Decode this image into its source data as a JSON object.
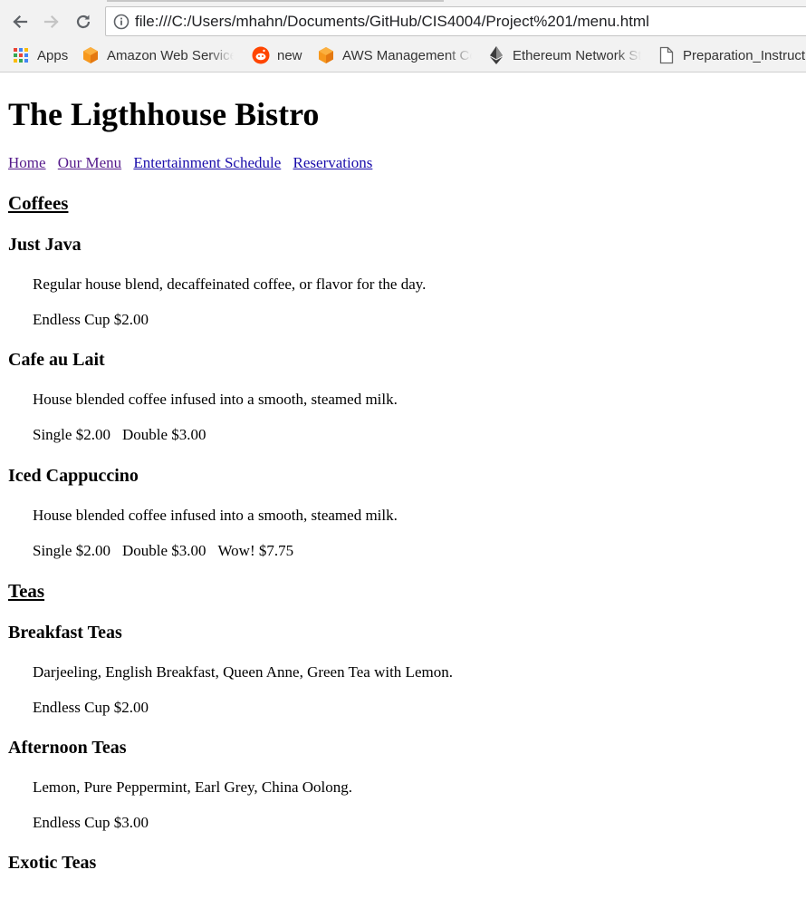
{
  "browser": {
    "url": "file:///C:/Users/mhahn/Documents/GitHub/CIS4004/Project%201/menu.html",
    "bookmarks": [
      {
        "label": "Apps",
        "icon": "apps-grid-icon"
      },
      {
        "label": "Amazon Web Service",
        "icon": "aws-cube-icon"
      },
      {
        "label": "new",
        "icon": "reddit-icon"
      },
      {
        "label": "AWS Management Co",
        "icon": "aws-cube-icon"
      },
      {
        "label": "Ethereum Network St",
        "icon": "ethereum-icon"
      },
      {
        "label": "Preparation_Instruct",
        "icon": "document-icon"
      }
    ]
  },
  "page": {
    "title": "The Ligthhouse Bistro",
    "nav": [
      "Home",
      "Our Menu",
      "Entertainment Schedule",
      "Reservations"
    ],
    "sections": [
      {
        "heading": "Coffees",
        "items": [
          {
            "name": "Just Java",
            "description": "Regular house blend, decaffeinated coffee, or flavor for the day.",
            "prices": [
              "Endless Cup $2.00"
            ]
          },
          {
            "name": "Cafe au Lait",
            "description": "House blended coffee infused into a smooth, steamed milk.",
            "prices": [
              "Single $2.00",
              "Double $3.00"
            ]
          },
          {
            "name": "Iced Cappuccino",
            "description": "House blended coffee infused into a smooth, steamed milk.",
            "prices": [
              "Single $2.00",
              "Double $3.00",
              "Wow! $7.75"
            ]
          }
        ]
      },
      {
        "heading": "Teas",
        "items": [
          {
            "name": "Breakfast Teas",
            "description": "Darjeeling, English Breakfast, Queen Anne, Green Tea with Lemon.",
            "prices": [
              "Endless Cup $2.00"
            ]
          },
          {
            "name": "Afternoon Teas",
            "description": "Lemon, Pure Peppermint, Earl Grey, China Oolong.",
            "prices": [
              "Endless Cup $3.00"
            ]
          },
          {
            "name": "Exotic Teas",
            "description": "",
            "prices": []
          }
        ]
      }
    ]
  }
}
